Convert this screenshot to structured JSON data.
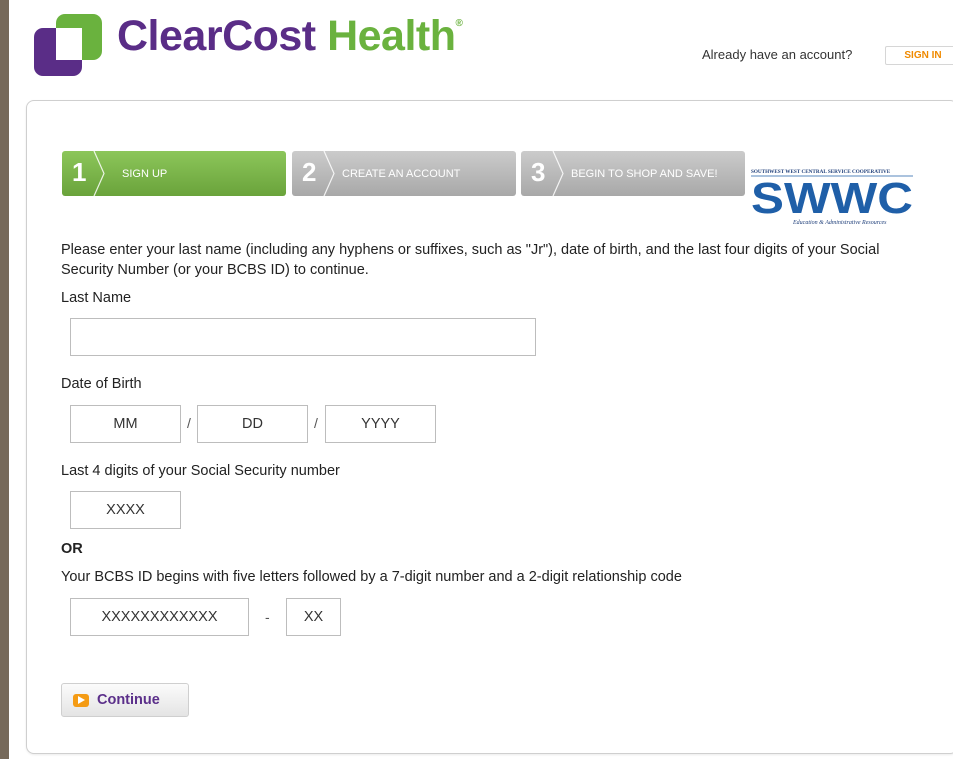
{
  "header": {
    "brand_part1": "ClearCost",
    "brand_part2": "Health",
    "brand_mark": "®",
    "account_prompt": "Already have an account?",
    "signin_label": "SIGN IN"
  },
  "steps": [
    {
      "number": "1",
      "label": "SIGN UP",
      "state": "active"
    },
    {
      "number": "2",
      "label": "CREATE AN ACCOUNT",
      "state": "inactive"
    },
    {
      "number": "3",
      "label": "BEGIN TO SHOP AND SAVE!",
      "state": "inactive"
    }
  ],
  "partner_logo": {
    "top_text": "SOUTHWEST WEST CENTRAL SERVICE COOPERATIVE",
    "name": "SWWC",
    "tagline": "Education & Administrative Resources"
  },
  "form": {
    "intro": "Please enter your last name (including any hyphens or suffixes, such as \"Jr\"), date of birth, and the last four digits of your Social Security Number (or your BCBS ID) to continue.",
    "last_name_label": "Last Name",
    "last_name_value": "",
    "dob_label": "Date of Birth",
    "dob_month_placeholder": "MM",
    "dob_day_placeholder": "DD",
    "dob_year_placeholder": "YYYY",
    "dob_separator": "/",
    "ssn_label": "Last 4 digits of your Social Security number",
    "ssn_placeholder": "XXXX",
    "or_label": "OR",
    "bcbs_label": "Your BCBS ID begins with five letters followed by a 7-digit number and a 2-digit relationship code",
    "bcbs_id_placeholder": "XXXXXXXXXXXX",
    "bcbs_separator": "-",
    "bcbs_code_placeholder": "XX",
    "continue_label": "Continue"
  },
  "colors": {
    "brand_purple": "#5a2d87",
    "brand_green": "#6ab23e",
    "signin_orange": "#f08a00",
    "active_step": "#7bb84a",
    "inactive_step": "#b9b9b9",
    "swwc_blue": "#1f5fa8",
    "background": "#76695a"
  }
}
